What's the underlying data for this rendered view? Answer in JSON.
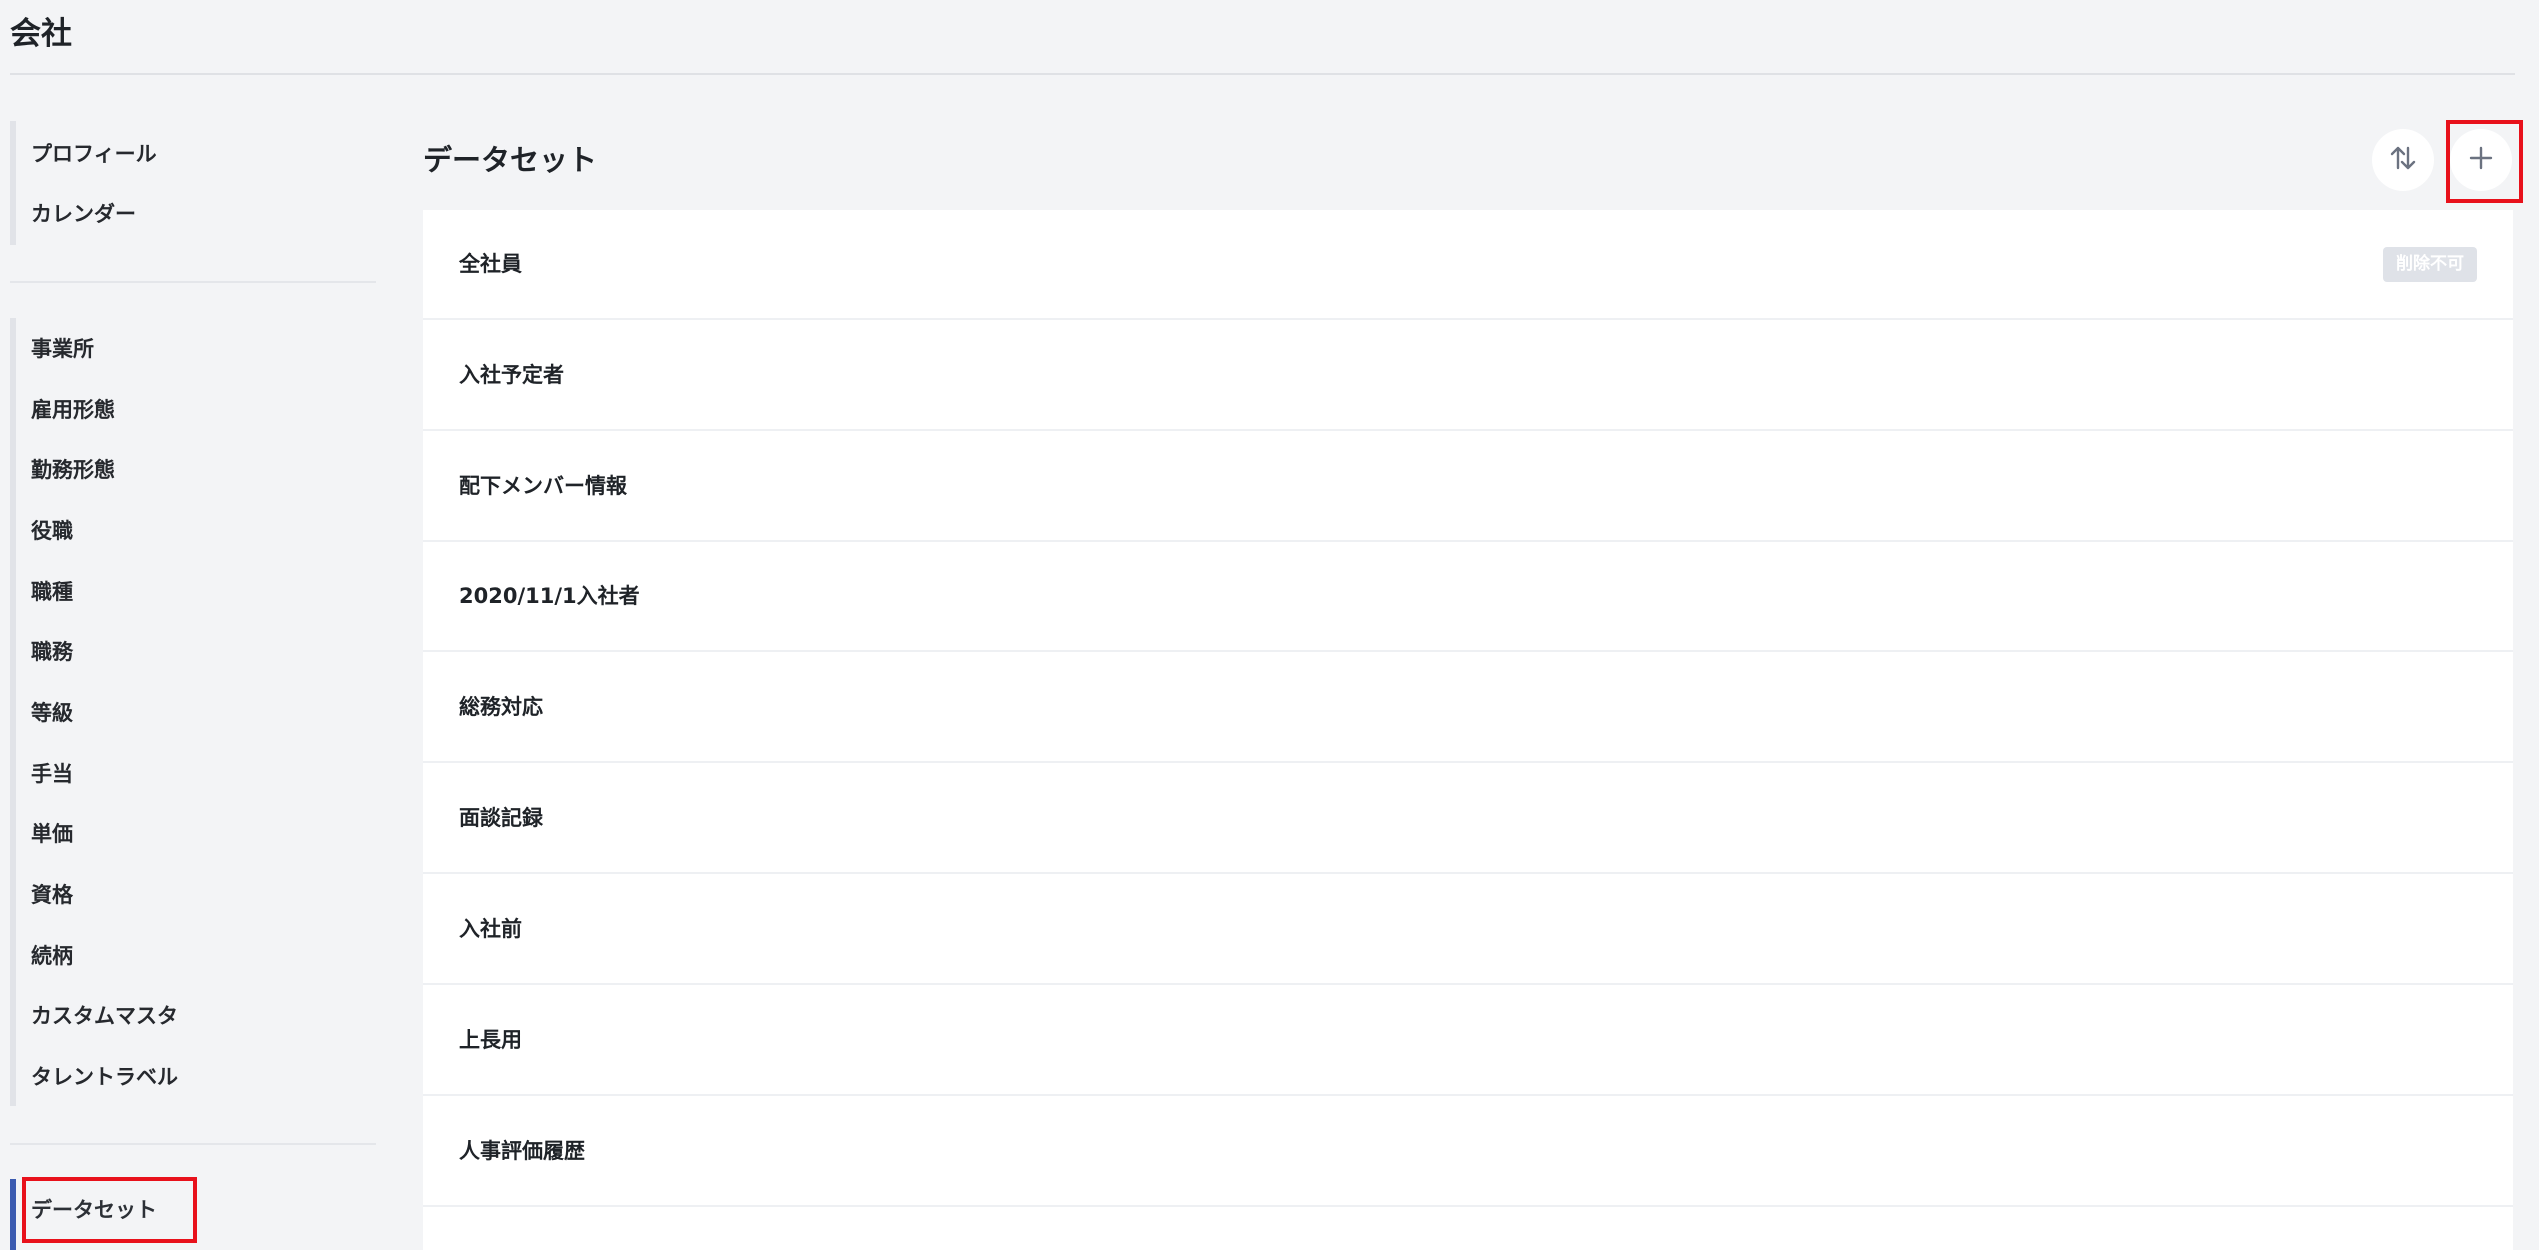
{
  "page": {
    "title": "会社"
  },
  "sidebar": {
    "group1": [
      {
        "label": "プロフィール"
      },
      {
        "label": "カレンダー"
      }
    ],
    "group2": [
      {
        "label": "事業所"
      },
      {
        "label": "雇用形態"
      },
      {
        "label": "勤務形態"
      },
      {
        "label": "役職"
      },
      {
        "label": "職種"
      },
      {
        "label": "職務"
      },
      {
        "label": "等級"
      },
      {
        "label": "手当"
      },
      {
        "label": "単価"
      },
      {
        "label": "資格"
      },
      {
        "label": "続柄"
      },
      {
        "label": "カスタムマスタ"
      },
      {
        "label": "タレントラベル"
      }
    ],
    "group3": [
      {
        "label": "データセット",
        "active": true
      }
    ]
  },
  "main": {
    "title": "データセット",
    "sort_icon": "sort-arrows-icon",
    "add_icon": "plus-icon",
    "rows": [
      {
        "label": "全社員",
        "badge": "削除不可"
      },
      {
        "label": "入社予定者"
      },
      {
        "label": "配下メンバー情報"
      },
      {
        "label": "2020/11/1入社者"
      },
      {
        "label": "総務対応"
      },
      {
        "label": "面談記録"
      },
      {
        "label": "入社前"
      },
      {
        "label": "上長用"
      },
      {
        "label": "人事評価履歴"
      }
    ]
  },
  "colors": {
    "background": "#f3f4f6",
    "panel": "#ffffff",
    "active_indicator": "#3b5bb0",
    "highlight": "#e8111b",
    "badge": "#dfe2e8"
  }
}
